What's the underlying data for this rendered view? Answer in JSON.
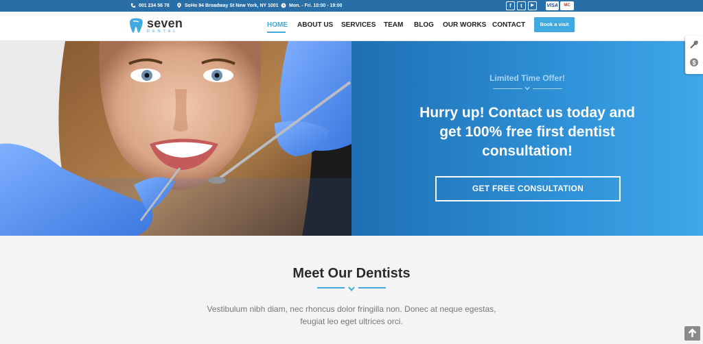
{
  "topbar": {
    "phone": "001 234 56 78",
    "address": "SoHo 94 Broadway St New York, NY 1001",
    "hours": "Mon. - Fri. 10:00 - 19:00",
    "social": [
      "f",
      "t",
      "▶"
    ],
    "cards": [
      "VISA",
      "MC"
    ]
  },
  "logo": {
    "name": "seven",
    "sub": "DENTAL"
  },
  "nav": {
    "items": [
      "HOME",
      "ABOUT US",
      "SERVICES",
      "TEAM",
      "BLOG",
      "OUR WORKS",
      "CONTACT"
    ],
    "active": "HOME",
    "book_label": "Book a visit"
  },
  "hero": {
    "offer": "Limited Time Offer!",
    "headline_line1": "Hurry up! Contact us today and",
    "headline_line2": "get 100% free first dentist",
    "headline_line3": "consultation!",
    "cta": "GET FREE CONSULTATION"
  },
  "section": {
    "title": "Meet Our Dentists",
    "text_line1": "Vestibulum nibh diam, nec rhoncus dolor fringilla non. Donec at neque egestas,",
    "text_line2": "feugiat leo eget ultrices orci."
  },
  "colors": {
    "accent": "#3fa9e0",
    "topbar": "#2a6ea8",
    "hero_blue": "#2d8ed4"
  },
  "icons": [
    "phone-icon",
    "location-icon",
    "clock-icon",
    "tooth-logo-icon",
    "wrench-icon",
    "dollar-icon",
    "arrow-up-icon"
  ]
}
